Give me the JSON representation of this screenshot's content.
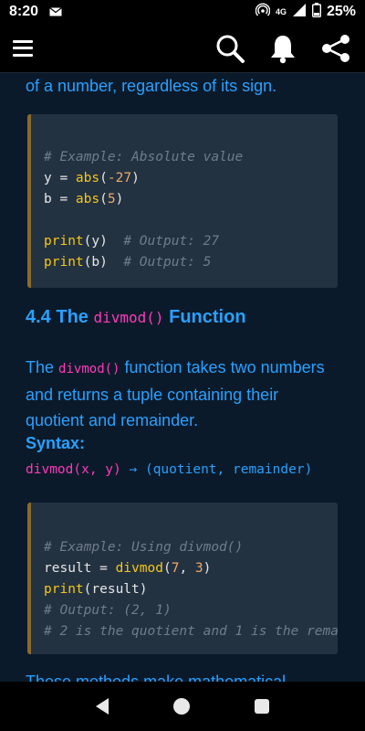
{
  "status_bar": {
    "time": "8:20",
    "network": "4G",
    "battery": "25%"
  },
  "app_bar": {
    "icons": [
      "menu-icon",
      "search-icon",
      "bell-icon",
      "share-icon"
    ]
  },
  "article": {
    "partial_top": "of a number, regardless of its sign.",
    "code1": {
      "comment": "# Example: Absolute value",
      "line_y": [
        "y = ",
        "abs",
        "(",
        "-27",
        ")"
      ],
      "line_b": [
        "b = ",
        "abs",
        "(",
        "5",
        ")"
      ],
      "print_y": [
        "print",
        "(y)",
        "# Output: 27"
      ],
      "print_b": [
        "print",
        "(b)",
        "# Output: 5"
      ]
    },
    "section_heading": {
      "number": "4.4 The",
      "code": "divmod()",
      "tail": "Function"
    },
    "paragraph": {
      "pre": "The",
      "code": "divmod()",
      "post_line1": "function takes two numbers",
      "line2": "and returns a tuple containing their",
      "line3": "quotient and remainder."
    },
    "syntax_label": "Syntax:",
    "syntax": {
      "call": "divmod(x, y)",
      "arrow": "→",
      "ret": "(quotient, remainder)"
    },
    "code2": {
      "comment1": "# Example: Using divmod()",
      "line1": [
        "result = ",
        "divmod",
        "(",
        "7",
        ", ",
        "3",
        ")"
      ],
      "line2": [
        "print",
        "(result)"
      ],
      "comment2": "# Output: (2, 1)",
      "comment3": "# 2 is the quotient and 1 is the rema"
    },
    "partial_bottom": "These methods make mathematical"
  },
  "colors": {
    "link": "#2aa0ff",
    "code_inline": "#ff39b8",
    "code_bg": "#233241",
    "accent_bar": "#8a6a2c"
  }
}
